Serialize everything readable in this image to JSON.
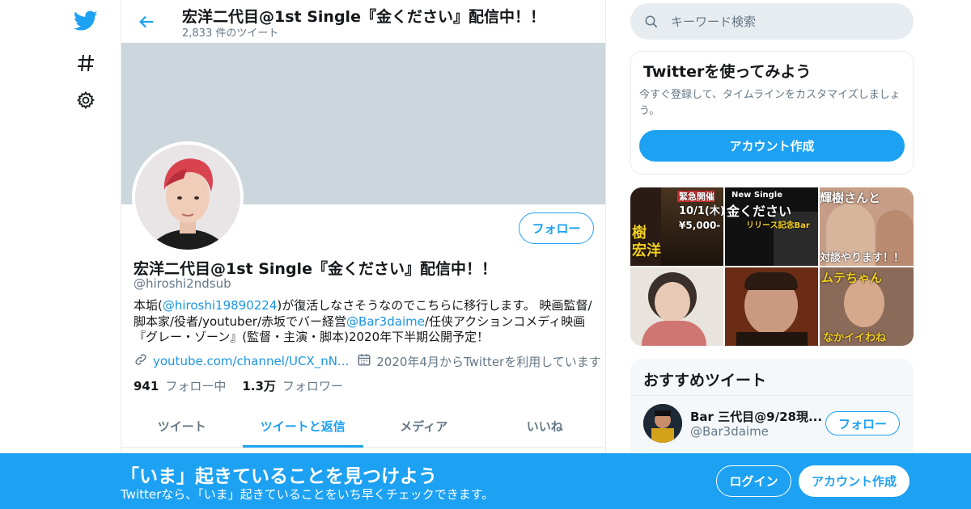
{
  "header": {
    "title": "宏洋二代目@1st Single『金ください』配信中！！",
    "tweet_count": "2,833 件のツイート"
  },
  "profile": {
    "name": "宏洋二代目@1st Single『金ください』配信中！！",
    "handle": "@hiroshi2ndsub",
    "follow_label": "フォロー",
    "bio_part1": "本垢(",
    "bio_link1": "@hiroshi19890224",
    "bio_part2": ")が復活しなさそうなのでこちらに移行します。 映画監督/脚本家/役者/youtuber/赤坂でバー経営",
    "bio_link2": "@Bar3daime",
    "bio_part3": "/任侠アクションコメディ映画『グレー・ゾーン』(監督・主演・脚本)2020年下半期公開予定！",
    "url": "youtube.com/channel/UCX_nN...",
    "joined": "2020年4月からTwitterを利用しています",
    "following_count": "941",
    "following_label": "フォロー中",
    "followers_count": "1.3万",
    "followers_label": "フォロワー"
  },
  "tabs": [
    {
      "label": "ツイート"
    },
    {
      "label": "ツイートと返信"
    },
    {
      "label": "メディア"
    },
    {
      "label": "いいね"
    }
  ],
  "search": {
    "placeholder": "キーワード検索"
  },
  "signup_card": {
    "title": "Twitterを使ってみよう",
    "description": "今すぐ登録して、タイムラインをカスタマイズしましょう。",
    "button": "アカウント作成"
  },
  "media_tiles": [
    {
      "caption1": "緊急開催",
      "caption2": "10/1(木)",
      "caption3": "¥5,000-",
      "caption4": "樹",
      "caption5": "宏洋"
    },
    {
      "caption1": "New Single",
      "caption2": "金ください",
      "caption3": "リリース記念Bar"
    },
    {
      "caption1": "輝樹さんと",
      "caption2": "対談やります！！"
    },
    {},
    {},
    {
      "caption1": "ムテちゃん",
      "caption2": "なかイイわね"
    }
  ],
  "recommend": {
    "title": "おすすめツイート",
    "name": "Bar 三代目@9/28現...",
    "handle": "@Bar3daime",
    "follow_label": "フォロー"
  },
  "bottombar": {
    "title": "「いま」起きていることを見つけよう",
    "subtitle": "Twitterなら、「いま」起きていることをいち早くチェックできます。",
    "login_label": "ログイン",
    "signup_label": "アカウント作成"
  },
  "colors": {
    "accent": "#1da1f2",
    "banner": "#ccd6dd"
  }
}
